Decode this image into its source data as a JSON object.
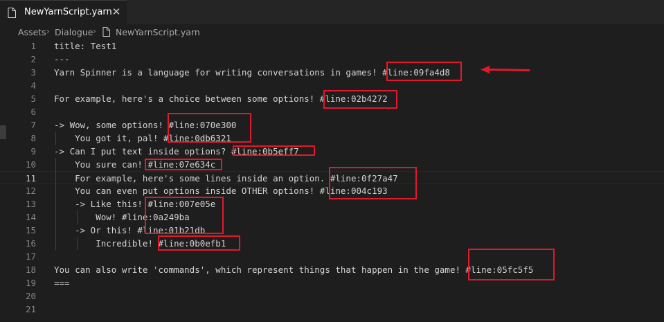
{
  "tab": {
    "title": "NewYarnScript.yarn",
    "close_glyph": "✕",
    "icon": "file-icon"
  },
  "breadcrumb": {
    "items": [
      "Assets",
      "Dialogue",
      "NewYarnScript.yarn"
    ],
    "separator": "›"
  },
  "editor": {
    "current_line": 11,
    "lines": [
      {
        "n": "1",
        "text": "title: Test1"
      },
      {
        "n": "2",
        "text": "---"
      },
      {
        "n": "3",
        "text": "Yarn Spinner is a language for writing conversations in games! #line:09fa4d8"
      },
      {
        "n": "4",
        "text": ""
      },
      {
        "n": "5",
        "text": "For example, here's a choice between some options! #line:02b4272"
      },
      {
        "n": "6",
        "text": ""
      },
      {
        "n": "7",
        "text": "-> Wow, some options! #line:070e300"
      },
      {
        "n": "8",
        "text": "    You got it, pal! #line:0db6321"
      },
      {
        "n": "9",
        "text": "-> Can I put text inside options? #line:0b5eff7"
      },
      {
        "n": "10",
        "text": "    You sure can! #line:07e634c"
      },
      {
        "n": "11",
        "text": "    For example, here's some lines inside an option. #line:0f27a47"
      },
      {
        "n": "12",
        "text": "    You can even put options inside OTHER options! #line:004c193"
      },
      {
        "n": "13",
        "text": "    -> Like this! #line:007e05e"
      },
      {
        "n": "14",
        "text": "        Wow! #line:0a249ba"
      },
      {
        "n": "15",
        "text": "    -> Or this! #line:01b21db"
      },
      {
        "n": "16",
        "text": "        Incredible! #line:0b0efb1"
      },
      {
        "n": "17",
        "text": ""
      },
      {
        "n": "18",
        "text": "You can also write 'commands', which represent things that happen in the game! #line:05fc5f5"
      },
      {
        "n": "19",
        "text": "==="
      },
      {
        "n": "20",
        "text": ""
      },
      {
        "n": "21",
        "text": ""
      }
    ]
  },
  "annotation_color": "#e3192b"
}
